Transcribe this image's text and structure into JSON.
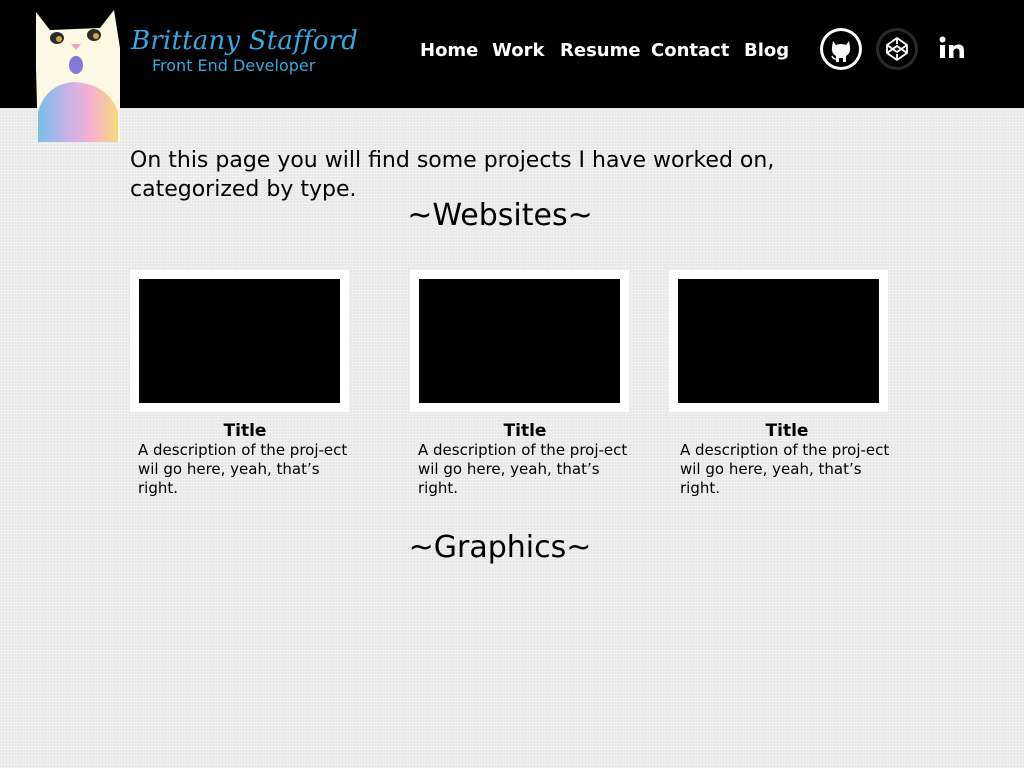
{
  "header": {
    "brand_name": "Brittany Stafford",
    "brand_tagline": "Front End Developer",
    "nav": [
      {
        "label": "Home"
      },
      {
        "label": "Work"
      },
      {
        "label": "Resume"
      },
      {
        "label": "Contact"
      },
      {
        "label": "Blog"
      }
    ],
    "social": [
      {
        "icon": "github-icon"
      },
      {
        "icon": "codepen-icon"
      },
      {
        "icon": "linkedin-icon"
      }
    ],
    "colors": {
      "background": "#000000",
      "brand": "#3aa7e0",
      "nav_text": "#ffffff"
    }
  },
  "main": {
    "intro": "On this page you will find some projects I have worked on, categorized by type.",
    "sections": [
      {
        "title": "~Websites~",
        "projects": [
          {
            "title": "Title",
            "description": "A description of the proj-ect wil go here, yeah, that’s right."
          },
          {
            "title": "Title",
            "description": "A description of the proj-ect wil go here, yeah, that’s right."
          },
          {
            "title": "Title",
            "description": "A description of the proj-ect wil go here, yeah, that’s right."
          }
        ]
      },
      {
        "title": "~Graphics~",
        "projects": []
      }
    ],
    "colors": {
      "page_background": "#ebebeb",
      "thumb_frame": "#ffffff",
      "thumb_fill": "#000000"
    }
  }
}
